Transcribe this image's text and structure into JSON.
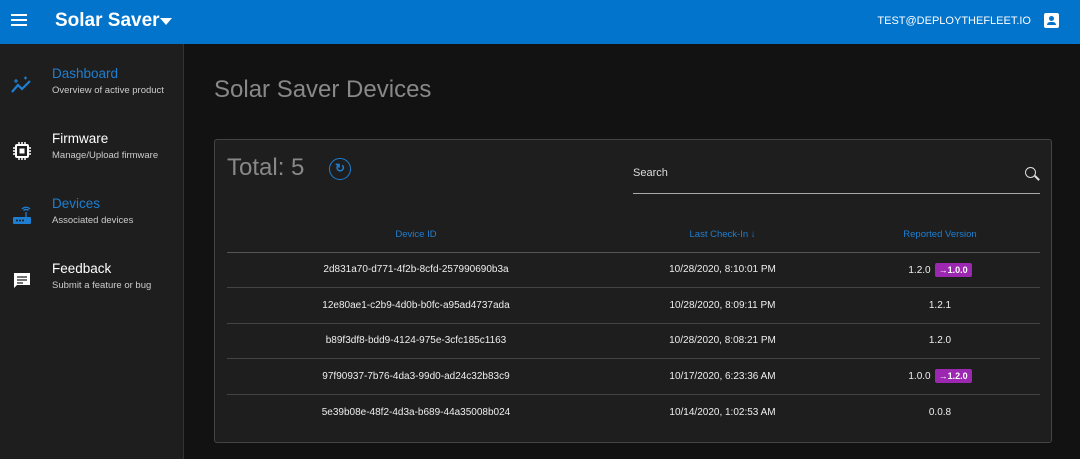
{
  "header": {
    "title": "Solar Saver",
    "user_email": "TEST@DEPLOYTHEFLEET.IO"
  },
  "sidebar": {
    "items": [
      {
        "label": "Dashboard",
        "sub": "Overview of active product",
        "icon": "chart-line-icon",
        "active": true
      },
      {
        "label": "Firmware",
        "sub": "Manage/Upload firmware",
        "icon": "chip-icon",
        "active": false
      },
      {
        "label": "Devices",
        "sub": "Associated devices",
        "icon": "router-icon",
        "active": true
      },
      {
        "label": "Feedback",
        "sub": "Submit a feature or bug",
        "icon": "feedback-icon",
        "active": false
      }
    ]
  },
  "main": {
    "title": "Solar Saver Devices",
    "total_label": "Total: 5",
    "search_placeholder": "Search",
    "columns": [
      "Device ID",
      "Last Check-In ↓",
      "Reported Version"
    ],
    "rows": [
      {
        "id": "2d831a70-d771-4f2b-8cfd-257990690b3a",
        "checkin": "10/28/2020, 8:10:01 PM",
        "version": "1.2.0",
        "target": "→1.0.0"
      },
      {
        "id": "12e80ae1-c2b9-4d0b-b0fc-a95ad4737ada",
        "checkin": "10/28/2020, 8:09:11 PM",
        "version": "1.2.1",
        "target": null
      },
      {
        "id": "b89f3df8-bdd9-4124-975e-3cfc185c1163",
        "checkin": "10/28/2020, 8:08:21 PM",
        "version": "1.2.0",
        "target": null
      },
      {
        "id": "97f90937-7b76-4da3-99d0-ad24c32b83c9",
        "checkin": "10/17/2020, 6:23:36 AM",
        "version": "1.0.0",
        "target": "→1.2.0"
      },
      {
        "id": "5e39b08e-48f2-4d3a-b689-44a35008b024",
        "checkin": "10/14/2020, 1:02:53 AM",
        "version": "0.0.8",
        "target": null
      }
    ]
  },
  "colors": {
    "primary": "#0274cc",
    "accent": "#1e7fd2",
    "badge": "#9c27b0"
  }
}
